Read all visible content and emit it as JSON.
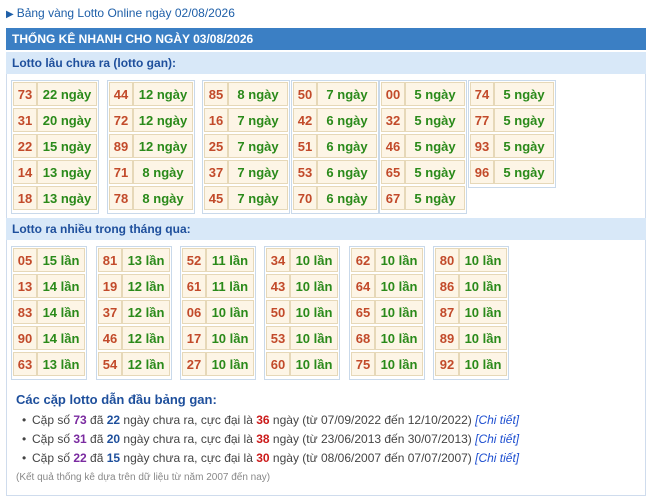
{
  "header": {
    "link_text": "Bảng vàng Lotto Online ngày 02/08/2026"
  },
  "title": "THỐNG KÊ NHANH CHO NGÀY 03/08/2026",
  "gan": {
    "heading": "Lotto lâu chưa ra (lotto gan):",
    "columns": [
      [
        [
          "73",
          "22 ngày"
        ],
        [
          "31",
          "20 ngày"
        ],
        [
          "22",
          "15 ngày"
        ],
        [
          "14",
          "13 ngày"
        ],
        [
          "18",
          "13 ngày"
        ]
      ],
      [
        [
          "44",
          "12 ngày"
        ],
        [
          "72",
          "12 ngày"
        ],
        [
          "89",
          "12 ngày"
        ],
        [
          "71",
          "8 ngày"
        ],
        [
          "78",
          "8 ngày"
        ]
      ],
      [
        [
          "85",
          "8 ngày"
        ],
        [
          "16",
          "7 ngày"
        ],
        [
          "25",
          "7 ngày"
        ],
        [
          "37",
          "7 ngày"
        ],
        [
          "45",
          "7 ngày"
        ]
      ],
      [
        [
          "50",
          "7 ngày"
        ],
        [
          "42",
          "6 ngày"
        ],
        [
          "51",
          "6 ngày"
        ],
        [
          "53",
          "6 ngày"
        ],
        [
          "70",
          "6 ngày"
        ]
      ],
      [
        [
          "00",
          "5 ngày"
        ],
        [
          "32",
          "5 ngày"
        ],
        [
          "46",
          "5 ngày"
        ],
        [
          "65",
          "5 ngày"
        ],
        [
          "67",
          "5 ngày"
        ]
      ],
      [
        [
          "74",
          "5 ngày"
        ],
        [
          "77",
          "5 ngày"
        ],
        [
          "93",
          "5 ngày"
        ],
        [
          "96",
          "5 ngày"
        ]
      ]
    ]
  },
  "frequent": {
    "heading": "Lotto ra nhiều trong tháng qua:",
    "columns": [
      [
        [
          "05",
          "15 lần"
        ],
        [
          "13",
          "14 lần"
        ],
        [
          "83",
          "14 lần"
        ],
        [
          "90",
          "14 lần"
        ],
        [
          "63",
          "13 lần"
        ]
      ],
      [
        [
          "81",
          "13 lần"
        ],
        [
          "19",
          "12 lần"
        ],
        [
          "37",
          "12 lần"
        ],
        [
          "46",
          "12 lần"
        ],
        [
          "54",
          "12 lần"
        ]
      ],
      [
        [
          "52",
          "11 lần"
        ],
        [
          "61",
          "11 lần"
        ],
        [
          "06",
          "10 lần"
        ],
        [
          "17",
          "10 lần"
        ],
        [
          "27",
          "10 lần"
        ]
      ],
      [
        [
          "34",
          "10 lần"
        ],
        [
          "43",
          "10 lần"
        ],
        [
          "50",
          "10 lần"
        ],
        [
          "53",
          "10 lần"
        ],
        [
          "60",
          "10 lần"
        ]
      ],
      [
        [
          "62",
          "10 lần"
        ],
        [
          "64",
          "10 lần"
        ],
        [
          "65",
          "10 lần"
        ],
        [
          "68",
          "10 lần"
        ],
        [
          "75",
          "10 lần"
        ]
      ],
      [
        [
          "80",
          "10 lần"
        ],
        [
          "86",
          "10 lần"
        ],
        [
          "87",
          "10 lần"
        ],
        [
          "89",
          "10 lần"
        ],
        [
          "92",
          "10 lần"
        ]
      ]
    ]
  },
  "pairs": {
    "heading": "Các cặp lotto dẫn đầu bảng gan:",
    "items": [
      {
        "prefix": "Cặp số ",
        "num": "73",
        "t1": " đã ",
        "days": "22",
        "t2": " ngày chưa ra, cực đại là ",
        "max": "36",
        "t3": " ngày (từ 07/09/2022 đến 12/10/2022) ",
        "link": "[Chi tiết]"
      },
      {
        "prefix": "Cặp số ",
        "num": "31",
        "t1": " đã ",
        "days": "20",
        "t2": " ngày chưa ra, cực đại là ",
        "max": "38",
        "t3": " ngày (từ 23/06/2013 đến 30/07/2013) ",
        "link": "[Chi tiết]"
      },
      {
        "prefix": "Cặp số ",
        "num": "22",
        "t1": " đã ",
        "days": "15",
        "t2": " ngày chưa ra, cực đại là ",
        "max": "30",
        "t3": " ngày (từ 08/06/2007 đến 07/07/2007) ",
        "link": "[Chi tiết]"
      }
    ],
    "note": "(Kết quả thống kê dựa trên dữ liệu từ năm 2007 đến nay)"
  },
  "colors": {
    "title_bg": "#3b7fc4",
    "section_bg": "#d8e8f8",
    "number": "#c24a2a",
    "value": "#2a8a1a"
  }
}
